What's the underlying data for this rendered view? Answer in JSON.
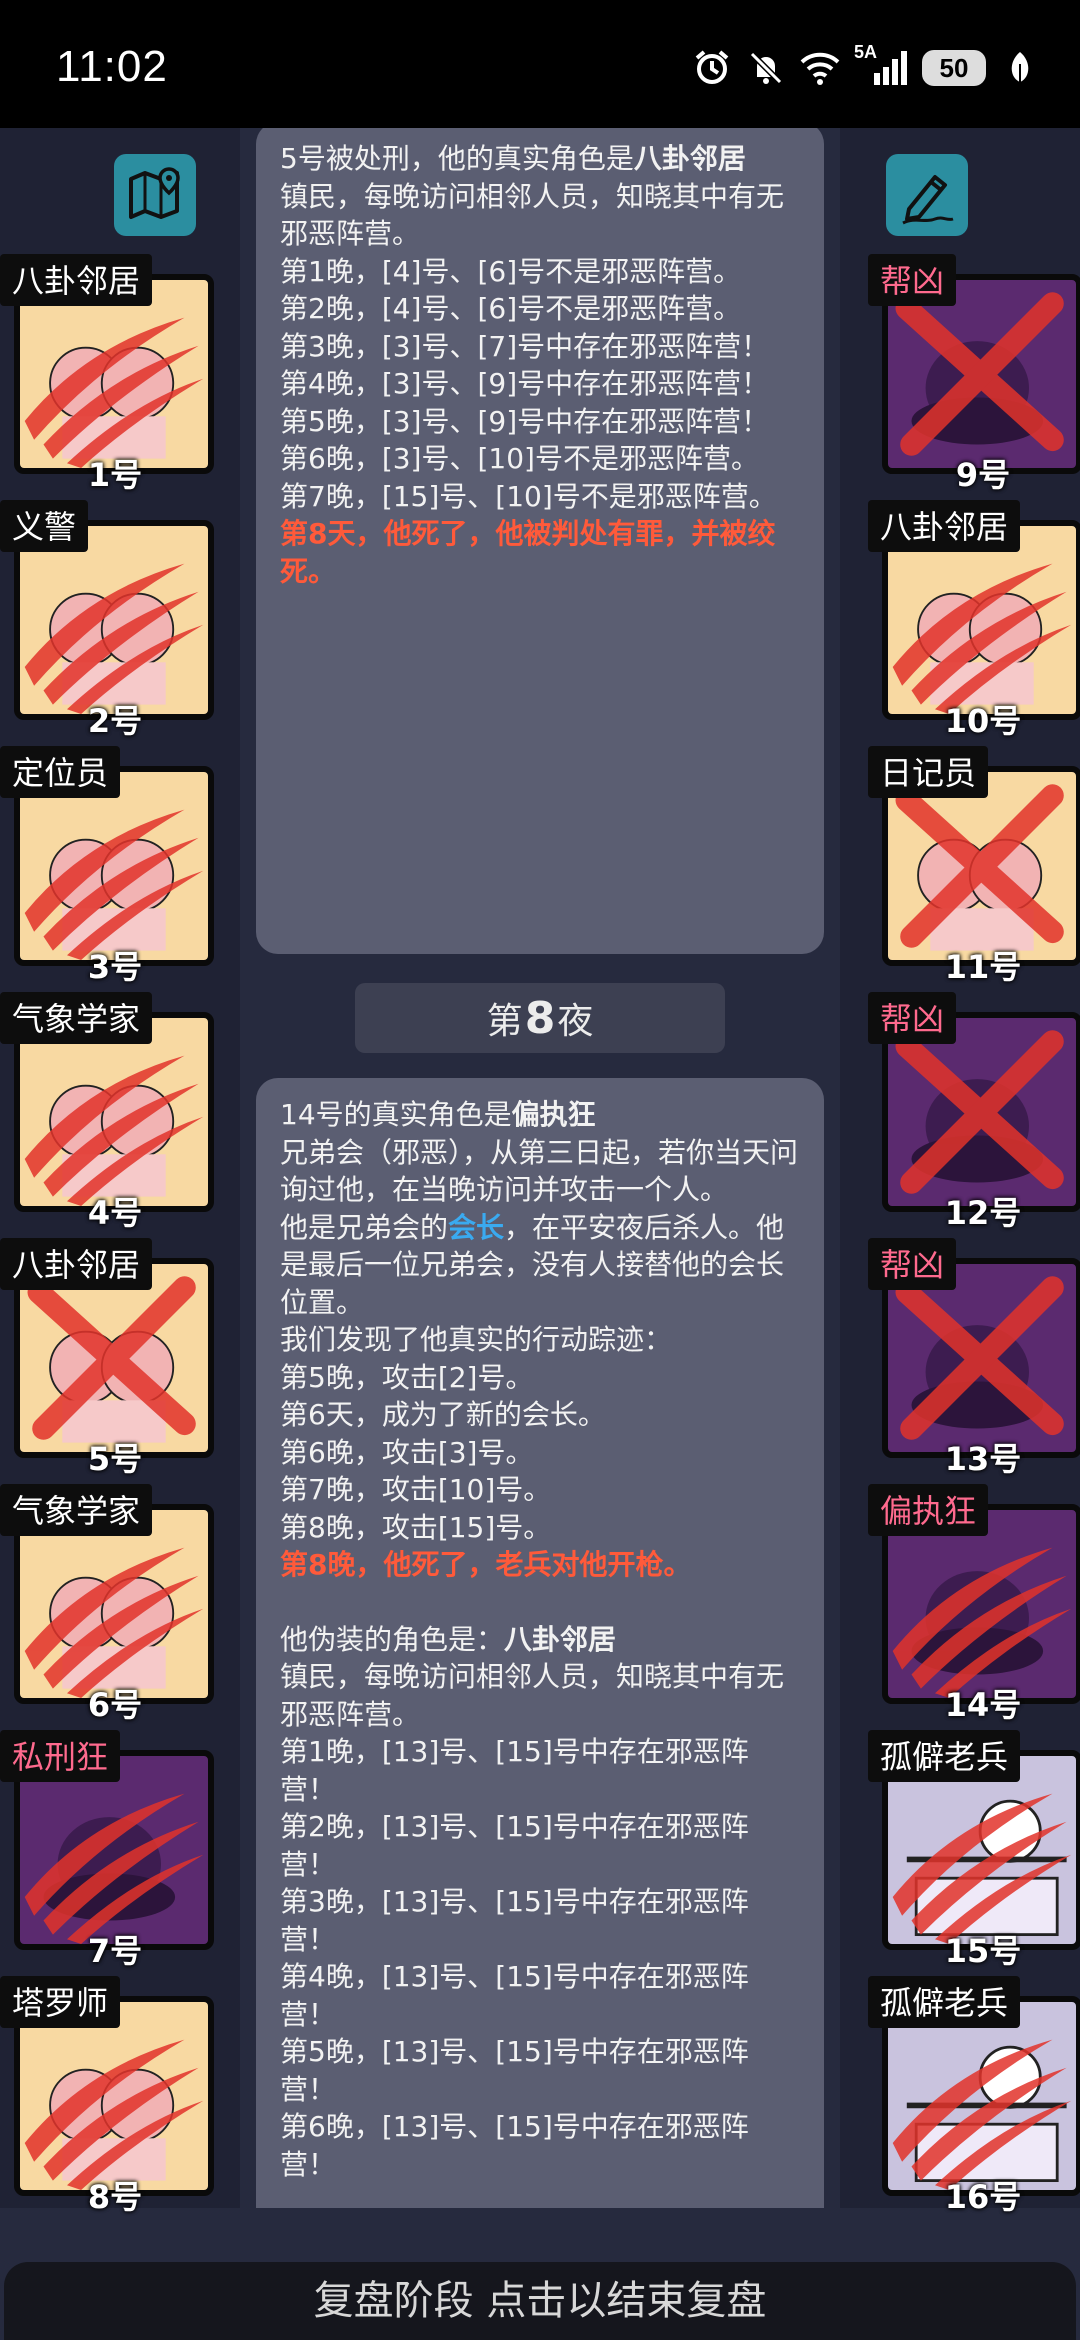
{
  "status_bar": {
    "time": "11:02",
    "battery": "50",
    "network": "5A"
  },
  "left_players": [
    {
      "role": "八卦邻居",
      "number": "1号",
      "bg": "peach",
      "mark": "claw"
    },
    {
      "role": "义警",
      "number": "2号",
      "bg": "peach",
      "mark": "claw"
    },
    {
      "role": "定位员",
      "number": "3号",
      "bg": "peach",
      "mark": "claw"
    },
    {
      "role": "气象学家",
      "number": "4号",
      "bg": "peach",
      "mark": "claw"
    },
    {
      "role": "八卦邻居",
      "number": "5号",
      "bg": "peach",
      "mark": "cross"
    },
    {
      "role": "气象学家",
      "number": "6号",
      "bg": "peach",
      "mark": "claw"
    },
    {
      "role": "私刑狂",
      "number": "7号",
      "bg": "purple",
      "mark": "claw",
      "role_color": "red"
    },
    {
      "role": "塔罗师",
      "number": "8号",
      "bg": "peach",
      "mark": "claw"
    }
  ],
  "right_players": [
    {
      "role": "帮凶",
      "number": "9号",
      "bg": "purple",
      "mark": "cross",
      "role_color": "red"
    },
    {
      "role": "八卦邻居",
      "number": "10号",
      "bg": "peach",
      "mark": "claw"
    },
    {
      "role": "日记员",
      "number": "11号",
      "bg": "peach",
      "mark": "cross"
    },
    {
      "role": "帮凶",
      "number": "12号",
      "bg": "purple",
      "mark": "cross",
      "role_color": "red"
    },
    {
      "role": "帮凶",
      "number": "13号",
      "bg": "purple",
      "mark": "cross",
      "role_color": "red"
    },
    {
      "role": "偏执狂",
      "number": "14号",
      "bg": "purple",
      "mark": "claw",
      "role_color": "red"
    },
    {
      "role": "孤僻老兵",
      "number": "15号",
      "bg": "lav",
      "mark": "claw"
    },
    {
      "role": "孤僻老兵",
      "number": "16号",
      "bg": "lav",
      "mark": "claw"
    }
  ],
  "panel1": {
    "title_prefix": "5号被处刑，他的真实角色是",
    "title_role": "八卦邻居",
    "lines": [
      "镇民，每晚访问相邻人员，知晓其中有无邪恶阵营。",
      "第1晚，[4]号、[6]号不是邪恶阵营。",
      "第2晚，[4]号、[6]号不是邪恶阵营。",
      "第3晚，[3]号、[7]号中存在邪恶阵营！",
      "第4晚，[3]号、[9]号中存在邪恶阵营！",
      "第5晚，[3]号、[9]号中存在邪恶阵营！",
      "第6晚，[3]号、[10]号不是邪恶阵营。",
      "第7晚，[15]号、[10]号不是邪恶阵营。"
    ],
    "death": "第8天，他死了，他被判处有罪，并被绞死。"
  },
  "night_button": {
    "prefix": "第",
    "number": "8",
    "suffix": "夜"
  },
  "panel2": {
    "title_prefix": "14号的真实角色是",
    "title_role": "偏执狂",
    "desc": "兄弟会（邪恶），从第三日起，若你当天问询过他，在当晚访问并攻击一个人。",
    "leader_prefix": "他是兄弟会的",
    "leader_word": "会长",
    "leader_suffix": "，在平安夜后杀人。他是最后一位兄弟会，没有人接替他的会长位置。",
    "track_title": "我们发现了他真实的行动踪迹：",
    "track": [
      "第5晚，攻击[2]号。",
      "第6天，成为了新的会长。",
      "第6晚，攻击[3]号。",
      "第7晚，攻击[10]号。",
      "第8晚，攻击[15]号。"
    ],
    "death": "第8晚，他死了，老兵对他开枪。",
    "fake_prefix": "他伪装的角色是：",
    "fake_role": "八卦邻居",
    "fake_desc": "镇民，每晚访问相邻人员，知晓其中有无邪恶阵营。",
    "fake_lines": [
      "第1晚，[13]号、[15]号中存在邪恶阵营！",
      "第2晚，[13]号、[15]号中存在邪恶阵营！",
      "第3晚，[13]号、[15]号中存在邪恶阵营！",
      "第4晚，[13]号、[15]号中存在邪恶阵营！",
      "第5晚，[13]号、[15]号中存在邪恶阵营！",
      "第6晚，[13]号、[15]号中存在邪恶阵营！"
    ]
  },
  "bottom_bar": {
    "label": "复盘阶段 点击以结束复盘"
  },
  "colors": {
    "accent_button": "#2b8ea0",
    "death_text": "#ff5a3a",
    "leader_text": "#3aaaf0",
    "evil_role": "#ff6a8e"
  }
}
